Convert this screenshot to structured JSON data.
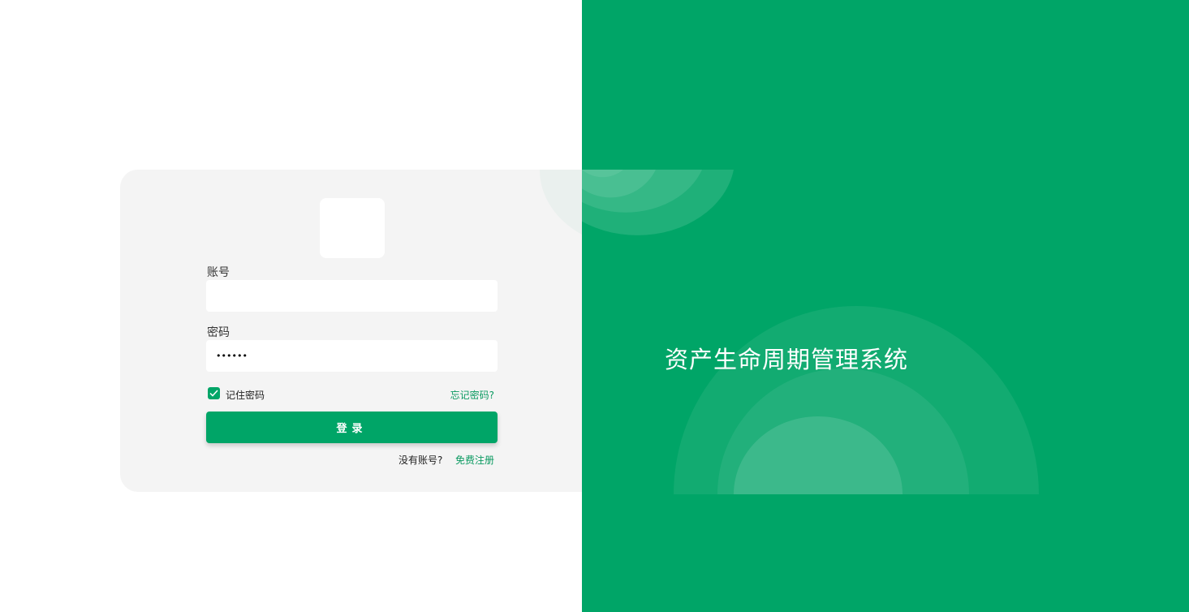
{
  "app": {
    "title": "资产生命周期管理系统"
  },
  "login_form": {
    "account_label": "账号",
    "account_value": "",
    "password_label": "密码",
    "password_value": "••••••",
    "remember_label": "记住密码",
    "remember_checked": true,
    "forgot_label": "忘记密码?",
    "login_button": "登录",
    "no_account_text": "没有账号?",
    "register_link": "免费注册"
  },
  "colors": {
    "brand_green": "#00a567",
    "card_bg": "#f4f4f4",
    "link_green": "#0b9a61"
  }
}
